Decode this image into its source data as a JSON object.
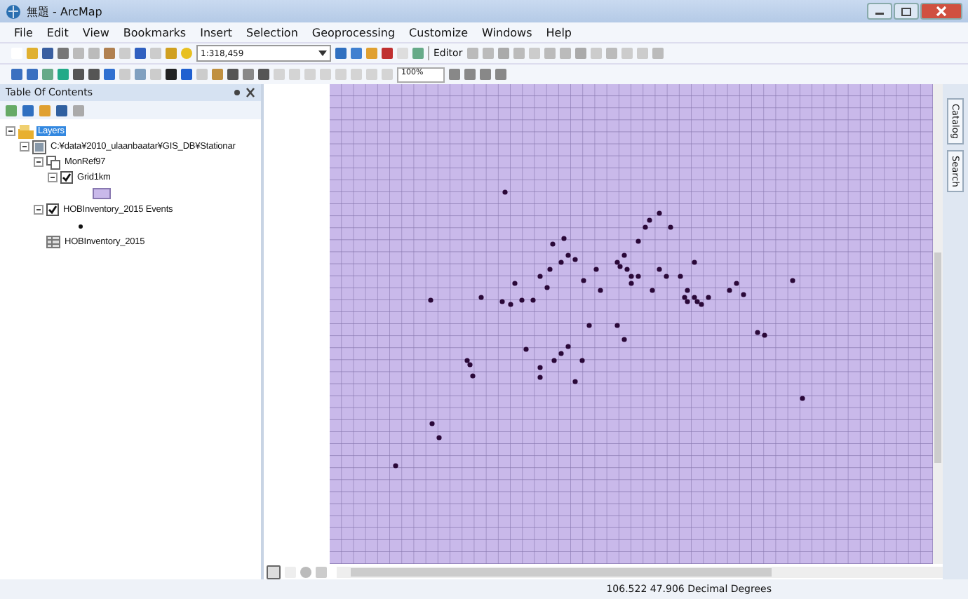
{
  "window": {
    "title": "無題 - ArcMap"
  },
  "menu": [
    "File",
    "Edit",
    "View",
    "Bookmarks",
    "Insert",
    "Selection",
    "Geoprocessing",
    "Customize",
    "Windows",
    "Help"
  ],
  "toolbar": {
    "scale": "1:318,459",
    "editor": "Editor",
    "zoom": "100%"
  },
  "toc": {
    "title": "Table Of Contents",
    "tree": [
      {
        "label": "Layers",
        "kind": "frame",
        "expanded": true,
        "selected": true,
        "children": [
          {
            "label": "C:¥data¥2010_ulaanbaatar¥GIS_DB¥Stationar",
            "kind": "folder",
            "expanded": true,
            "selected": false,
            "children": [
              {
                "label": "MonRef97",
                "kind": "group",
                "expanded": true,
                "selected": false,
                "children": [
                  {
                    "label": "Grid1km",
                    "kind": "layer",
                    "checked": true,
                    "expanded": true,
                    "selected": false,
                    "legend": {
                      "kind": "polygon"
                    }
                  }
                ]
              },
              {
                "label": "HOBInventory_2015 Events",
                "kind": "layer",
                "checked": true,
                "expanded": true,
                "selected": false,
                "legend": {
                  "kind": "point"
                }
              },
              {
                "label": "HOBInventory_2015",
                "kind": "table",
                "selected": false
              }
            ]
          }
        ]
      }
    ]
  },
  "dock_tabs": [
    "Catalog",
    "Search"
  ],
  "status_bar": {
    "coordinates": "106.522  47.906 Decimal Degrees"
  }
}
